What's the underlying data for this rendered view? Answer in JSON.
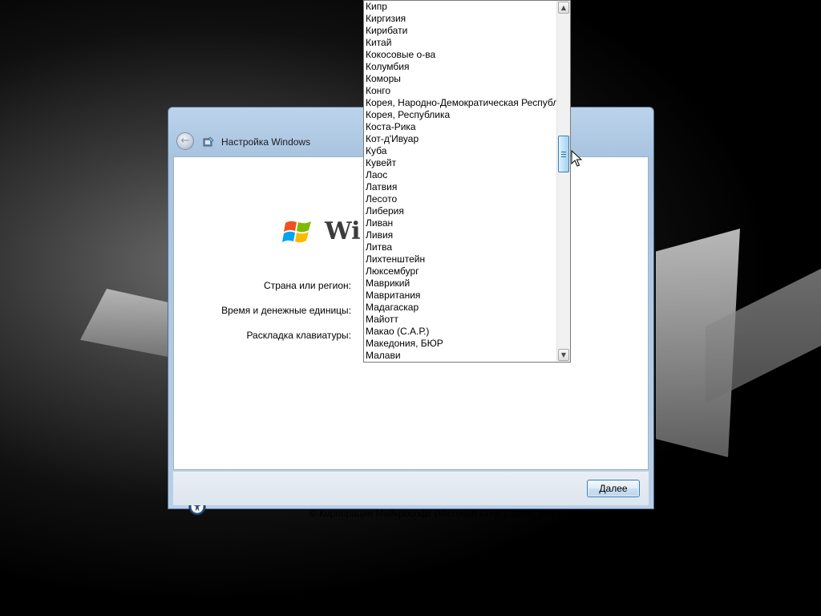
{
  "window": {
    "title": "Настройка Windows",
    "logo_text": "Wi"
  },
  "form": {
    "country_label": "Страна или регион:",
    "time_currency_label": "Время и денежные единицы:",
    "keyboard_label": "Раскладка клавиатуры:"
  },
  "footer": {
    "copyright": "© Корпорация Майкрософт (Microsoft Corp.), 2009. Все права защищены.",
    "next_label": "Далее"
  },
  "dropdown": {
    "items": [
      "Кипр",
      "Киргизия",
      "Кирибати",
      "Китай",
      "Кокосовые о-ва",
      "Колумбия",
      "Коморы",
      "Конго",
      "Корея, Народно-Демократическая Республ",
      "Корея, Республика",
      "Коста-Рика",
      "Кот-д'Ивуар",
      "Куба",
      "Кувейт",
      "Лаос",
      "Латвия",
      "Лесото",
      "Либерия",
      "Ливан",
      "Ливия",
      "Литва",
      "Лихтенштейн",
      "Люксембург",
      "Маврикий",
      "Мавритания",
      "Мадагаскар",
      "Майотт",
      "Макао (С.А.Р.)",
      "Македония, БЮР",
      "Малави"
    ],
    "scroll_position": 0.38
  },
  "icons": {
    "back": "back-arrow-icon",
    "app": "setup-icon",
    "logo": "windows-logo-icon",
    "help": "accessibility-icon",
    "scroll_up": "scroll-up-arrow-icon",
    "scroll_down": "scroll-down-arrow-icon"
  }
}
